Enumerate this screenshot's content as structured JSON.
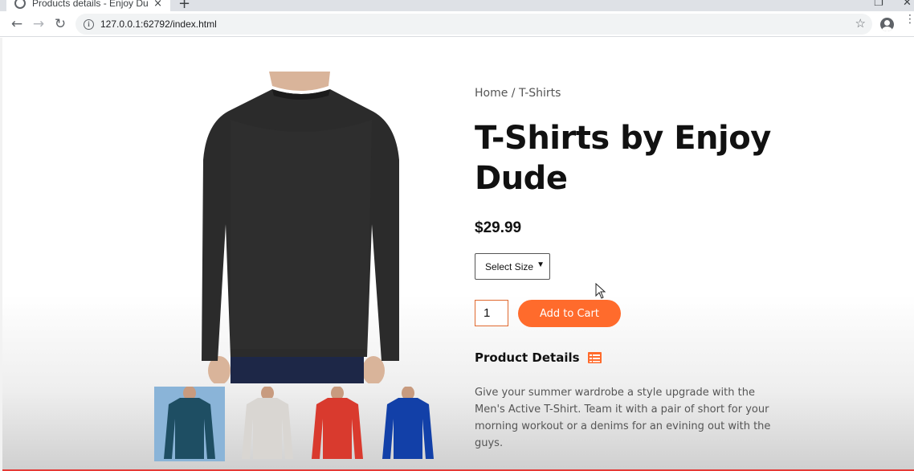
{
  "browser": {
    "tab_title": "Products details - Enjoy Dude",
    "tab_close": "×",
    "new_tab": "+",
    "url": "127.0.0.1:62792/index.html"
  },
  "product": {
    "breadcrumb": "Home / T-Shirts",
    "title": "T-Shirts by Enjoy Dude",
    "price": "$29.99",
    "size_select": {
      "selected": "Select Size"
    },
    "quantity": "1",
    "add_to_cart": "Add to Cart",
    "details_heading": "Product Details",
    "description": "Give your summer wardrobe a style upgrade with the Men's Active T-Shirt. Team it with a pair of short for your morning workout or a denims for an evining out with the guys.",
    "main_image_color": "#2b2b2b",
    "thumbnails": [
      {
        "color": "#1e4e63",
        "active": true
      },
      {
        "color": "#d9d6d2",
        "active": false
      },
      {
        "color": "#d93a2e",
        "active": false
      },
      {
        "color": "#1240a8",
        "active": false
      }
    ]
  },
  "colors": {
    "accent": "#ff6b2c"
  }
}
